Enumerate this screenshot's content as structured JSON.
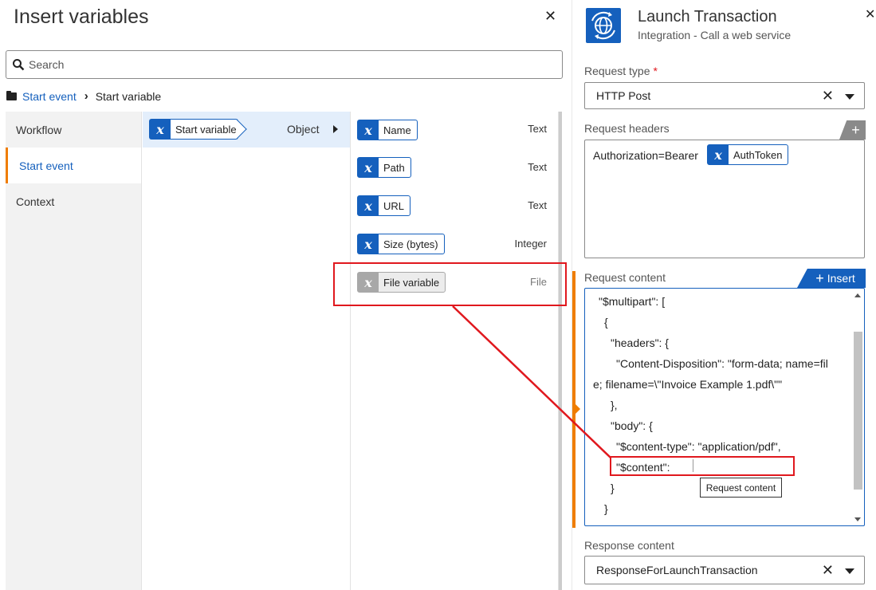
{
  "insert_panel": {
    "title": "Insert variables",
    "search_placeholder": "Search",
    "breadcrumb": {
      "parent": "Start event",
      "current": "Start variable"
    },
    "categories": [
      {
        "label": "Workflow",
        "active": false
      },
      {
        "label": "Start event",
        "active": true
      },
      {
        "label": "Context",
        "active": false
      }
    ],
    "parent_variable": {
      "label": "Start variable",
      "type": "Object"
    },
    "child_variables": [
      {
        "label": "Name",
        "type": "Text"
      },
      {
        "label": "Path",
        "type": "Text"
      },
      {
        "label": "URL",
        "type": "Text"
      },
      {
        "label": "Size (bytes)",
        "type": "Integer"
      },
      {
        "label": "File variable",
        "type": "File"
      }
    ]
  },
  "action_panel": {
    "title": "Launch Transaction",
    "subtitle": "Integration - Call a web service",
    "request_type": {
      "label": "Request type",
      "value": "HTTP Post"
    },
    "request_headers": {
      "label": "Request headers",
      "text": "Authorization=Bearer",
      "token": "AuthToken"
    },
    "request_content": {
      "label": "Request content",
      "insert_label": "Insert",
      "lines": [
        "\"$multipart\": [",
        "{",
        "\"headers\": {",
        "\"Content-Disposition\": \"form-data; name=fil",
        "e; filename=\\\"Invoice Example 1.pdf\\\"\"",
        "},",
        "\"body\": {",
        "\"$content-type\": \"application/pdf\",",
        "\"$content\":",
        "}",
        "}"
      ]
    },
    "tooltip": "Request content",
    "response_content": {
      "label": "Response content",
      "value": "ResponseForLaunchTransaction"
    }
  },
  "colors": {
    "accent": "#1560bd",
    "active_marker": "#ef7d00",
    "annotation": "#e0181e"
  }
}
